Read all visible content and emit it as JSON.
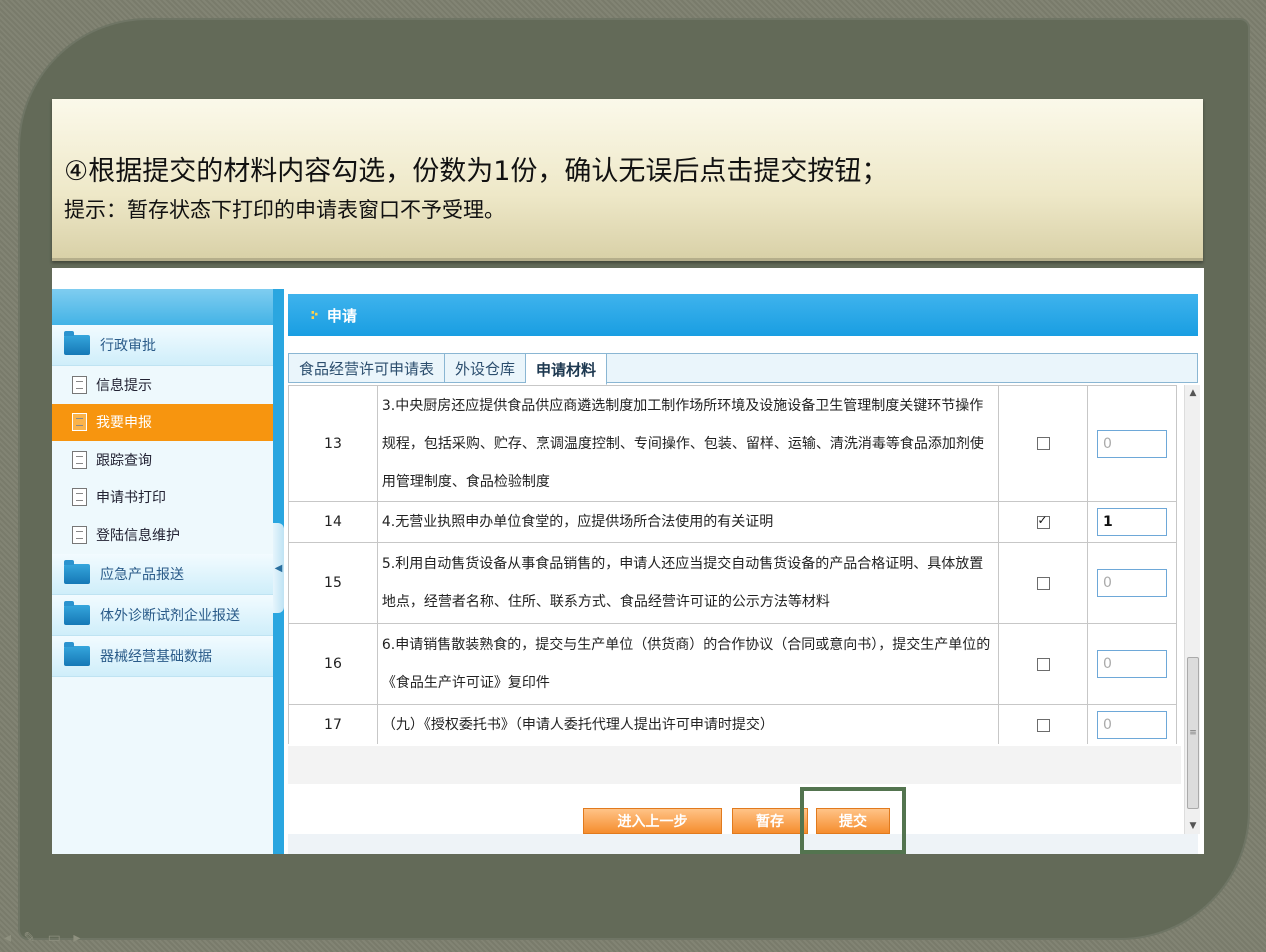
{
  "instruction": {
    "main": "④根据提交的材料内容勾选，份数为1份，确认无误后点击提交按钮；",
    "tip": "提示：暂存状态下打印的申请表窗口不予受理。"
  },
  "sidebar": {
    "groups": [
      {
        "label": "行政审批",
        "icon": "folder-icon"
      },
      {
        "label": "应急产品报送",
        "icon": "folder-icon"
      },
      {
        "label": "体外诊断试剂企业报送",
        "icon": "folder-icon"
      },
      {
        "label": "器械经营基础数据",
        "icon": "folder-icon"
      }
    ],
    "items": [
      {
        "label": "信息提示",
        "icon": "document-icon",
        "active": false
      },
      {
        "label": "我要申报",
        "icon": "document-icon",
        "active": true
      },
      {
        "label": "跟踪查询",
        "icon": "document-icon",
        "active": false
      },
      {
        "label": "申请书打印",
        "icon": "document-icon",
        "active": false
      },
      {
        "label": "登陆信息维护",
        "icon": "document-icon",
        "active": false
      }
    ]
  },
  "panel": {
    "title": "申请",
    "title_icon": "dots-icon"
  },
  "tabs": [
    {
      "label": "食品经营许可申请表",
      "selected": false
    },
    {
      "label": "外设仓库",
      "selected": false
    },
    {
      "label": "申请材料",
      "selected": true
    }
  ],
  "table": {
    "rows": [
      {
        "no": "13",
        "desc": "3.中央厨房还应提供食品供应商遴选制度加工制作场所环境及设施设备卫生管理制度关键环节操作规程，包括采购、贮存、烹调温度控制、专间操作、包装、留样、运输、清洗消毒等食品添加剂使用管理制度、食品检验制度",
        "checked": false,
        "count": "0"
      },
      {
        "no": "14",
        "desc": "4.无营业执照申办单位食堂的，应提供场所合法使用的有关证明",
        "checked": true,
        "count": "1"
      },
      {
        "no": "15",
        "desc": "5.利用自动售货设备从事食品销售的，申请人还应当提交自动售货设备的产品合格证明、具体放置地点，经营者名称、住所、联系方式、食品经营许可证的公示方法等材料",
        "checked": false,
        "count": "0"
      },
      {
        "no": "16",
        "desc": "6.申请销售散装熟食的，提交与生产单位（供货商）的合作协议（合同或意向书），提交生产单位的《食品生产许可证》复印件",
        "checked": false,
        "count": "0"
      },
      {
        "no": "17",
        "desc": "（九）《授权委托书》（申请人委托代理人提出许可申请时提交）",
        "checked": false,
        "count": "0"
      }
    ]
  },
  "buttons": {
    "prev": "进入上一步",
    "save": "暂存",
    "submit": "提交"
  },
  "colors": {
    "accent": "#1e9fe2",
    "active_item": "#f7950f",
    "button": "#f58d2e",
    "highlight": "#53744f"
  }
}
